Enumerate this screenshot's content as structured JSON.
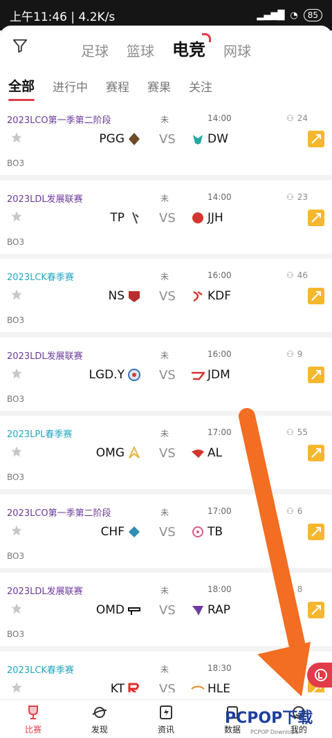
{
  "statusbar": {
    "left": "上午11:46 | 4.2K/s ",
    "battery": "85"
  },
  "sport_tabs": [
    "足球",
    "篮球",
    "电竞",
    "网球"
  ],
  "sub_tabs": [
    "全部",
    "进行中",
    "赛程",
    "赛果",
    "关注"
  ],
  "matches": [
    {
      "league": "2023LCO第一季第二阶段",
      "status": "未",
      "time": "14:00",
      "viewers": "24",
      "team_a": "PGG",
      "team_b": "DW",
      "bo": "BO3",
      "league_color": "purple"
    },
    {
      "league": "2023LDL发展联赛",
      "status": "未",
      "time": "14:00",
      "viewers": "23",
      "team_a": "TP",
      "team_b": "JJH",
      "bo": "BO3",
      "league_color": "purple"
    },
    {
      "league": "2023LCK春季赛",
      "status": "未",
      "time": "16:00",
      "viewers": "46",
      "team_a": "NS",
      "team_b": "KDF",
      "bo": "BO3",
      "league_color": "cyan"
    },
    {
      "league": "2023LDL发展联赛",
      "status": "未",
      "time": "16:00",
      "viewers": "9",
      "team_a": "LGD.Y",
      "team_b": "JDM",
      "bo": "BO3",
      "league_color": "purple"
    },
    {
      "league": "2023LPL春季赛",
      "status": "未",
      "time": "17:00",
      "viewers": "55",
      "team_a": "OMG",
      "team_b": "AL",
      "bo": "BO3",
      "league_color": "cyan"
    },
    {
      "league": "2023LCO第一季第二阶段",
      "status": "未",
      "time": "17:00",
      "viewers": "6",
      "team_a": "CHF",
      "team_b": "TB",
      "bo": "BO3",
      "league_color": "purple"
    },
    {
      "league": "2023LDL发展联赛",
      "status": "未",
      "time": "18:00",
      "viewers": "8",
      "team_a": "OMD",
      "team_b": "RAP",
      "bo": "BO3",
      "league_color": "purple"
    },
    {
      "league": "2023LCK春季赛",
      "status": "未",
      "time": "18:30",
      "viewers": "",
      "team_a": "KT",
      "team_b": "HLE",
      "bo": "",
      "league_color": "cyan"
    }
  ],
  "vs_text": "VS",
  "bottom_nav": [
    "比赛",
    "发现",
    "资讯",
    "数据",
    "我的"
  ],
  "watermark": {
    "main": "PCPOP下载",
    "sub": "PCPOP Download"
  }
}
